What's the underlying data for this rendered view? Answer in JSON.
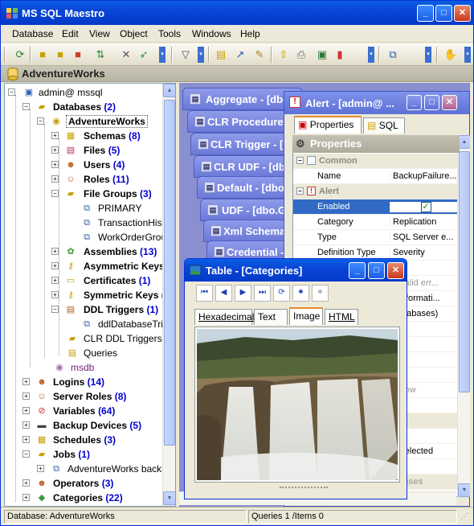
{
  "app": {
    "title": "MS SQL Maestro",
    "window_buttons": {
      "minimize": "_",
      "maximize": "□",
      "close": "✕"
    }
  },
  "menu": [
    "Database",
    "Edit",
    "View",
    "Object",
    "Tools",
    "Windows",
    "Help"
  ],
  "document_header": "AdventureWorks",
  "tree": {
    "root": "admin@ mssql",
    "items": [
      {
        "label": "Databases",
        "count": "(2)"
      },
      {
        "label": "AdventureWorks",
        "count": ""
      },
      {
        "label": "Schemas",
        "count": "(8)"
      },
      {
        "label": "Files",
        "count": "(5)"
      },
      {
        "label": "Users",
        "count": "(4)"
      },
      {
        "label": "Roles",
        "count": "(11)"
      },
      {
        "label": "File Groups",
        "count": "(3)"
      },
      {
        "label": "PRIMARY",
        "count": ""
      },
      {
        "label": "TransactionHisto",
        "count": ""
      },
      {
        "label": "WorkOrderGroup",
        "count": ""
      },
      {
        "label": "Assemblies",
        "count": "(13)"
      },
      {
        "label": "Asymmetric Keys",
        "count": ""
      },
      {
        "label": "Certificates",
        "count": "(1)"
      },
      {
        "label": "Symmetric Keys",
        "count": "("
      },
      {
        "label": "DDL Triggers",
        "count": "(1)"
      },
      {
        "label": "ddlDatabaseTrig",
        "count": ""
      },
      {
        "label": "CLR DDL Triggers",
        "count": ""
      },
      {
        "label": "Queries",
        "count": ""
      },
      {
        "label": "msdb",
        "count": ""
      },
      {
        "label": "Logins",
        "count": "(14)"
      },
      {
        "label": "Server Roles",
        "count": "(8)"
      },
      {
        "label": "Variables",
        "count": "(64)"
      },
      {
        "label": "Backup Devices",
        "count": "(5)"
      },
      {
        "label": "Schedules",
        "count": "(3)"
      },
      {
        "label": "Jobs",
        "count": "(1)"
      },
      {
        "label": "AdventureWorks backu",
        "count": ""
      },
      {
        "label": "Operators",
        "count": "(3)"
      },
      {
        "label": "Categories",
        "count": "(22)"
      }
    ]
  },
  "mdi_windows": [
    "Aggregate - [dbo.",
    "CLR Procedure",
    "CLR Trigger - [",
    "CLR UDF - [dbo",
    "Default - [dbo",
    "UDF - [dbo.G",
    "Xml Schema",
    "Credential -"
  ],
  "alert_window": {
    "title": "Alert - [admin@ ...",
    "tabs": [
      "Properties",
      "SQL"
    ],
    "section_title": "Properties",
    "rows": [
      {
        "key": "Common",
        "value": "",
        "category": true
      },
      {
        "key": "Name",
        "value": "BackupFailure..."
      },
      {
        "key": "Alert",
        "value": "",
        "category": true
      },
      {
        "key": "Enabled",
        "value": "✓"
      },
      {
        "key": "Category",
        "value": "Replication"
      },
      {
        "key": "Type",
        "value": "SQL Server e..."
      },
      {
        "key": "Definition Type",
        "value": "Severity"
      },
      {
        "key": "",
        "value": ""
      },
      {
        "key": "",
        "value": "a valid err..."
      },
      {
        "key": "",
        "value": "- Informati..."
      },
      {
        "key": "",
        "value": "Databases)"
      },
      {
        "key": "",
        "value": ""
      },
      {
        "key": "",
        "value": ""
      },
      {
        "key": "",
        "value": ""
      },
      {
        "key": "",
        "value": ""
      },
      {
        "key": "",
        "value": "below"
      },
      {
        "key": "",
        "value": ""
      },
      {
        "key": "",
        "value": ""
      },
      {
        "key": "",
        "value": "e)"
      },
      {
        "key": "",
        "value": "e selected"
      },
      {
        "key": "",
        "value": ""
      },
      {
        "key": "",
        "value": "ponses"
      }
    ]
  },
  "table_window": {
    "title": "Table - [Categories]",
    "tabs": [
      "Hexadecimal",
      "Text",
      "Image",
      "HTML"
    ],
    "active_tab": "Image",
    "image_label": "waterfall photo"
  },
  "status": {
    "database": "Database: AdventureWorks",
    "queries": "Queries 1 /Items 0"
  }
}
